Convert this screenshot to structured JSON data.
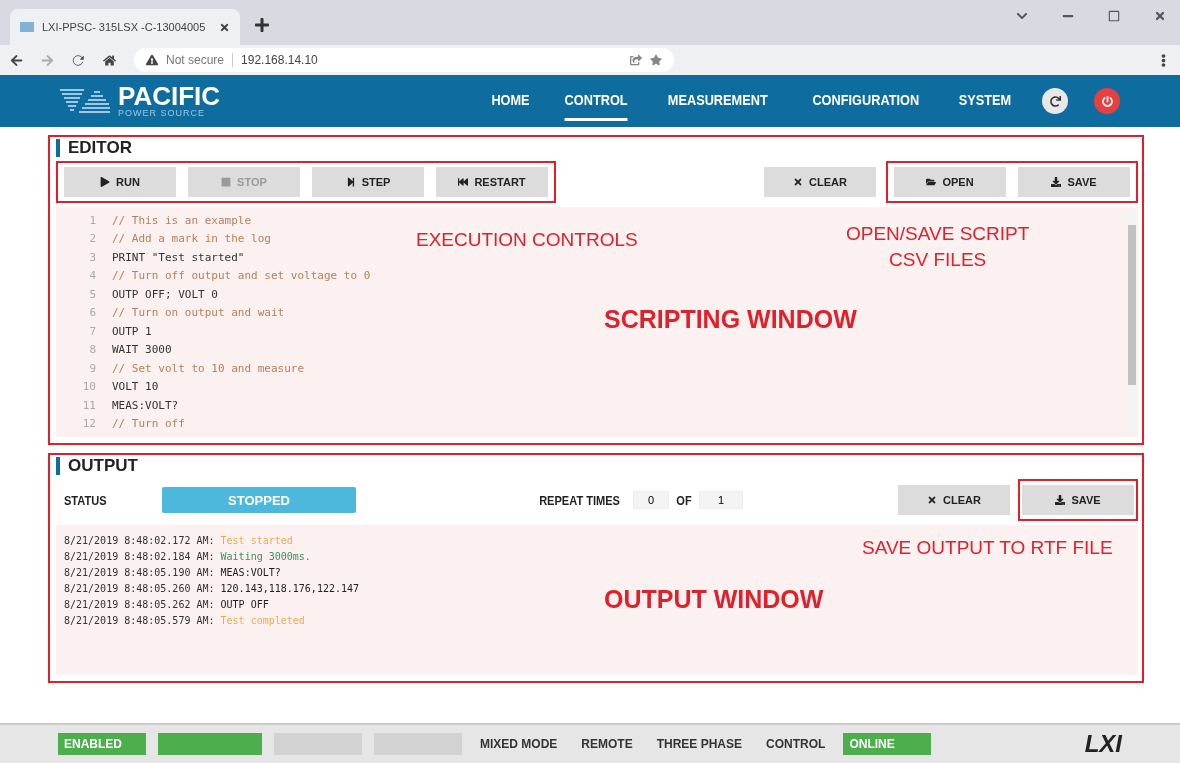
{
  "browser": {
    "tab_title": "LXI-PPSC- 315LSX -C-13004005",
    "security": "Not secure",
    "url": "192.168.14.10"
  },
  "header": {
    "logo_title": "PACIFIC",
    "logo_subtitle": "POWER SOURCE",
    "nav": [
      {
        "label": "HOME",
        "selected": false
      },
      {
        "label": "CONTROL",
        "selected": true
      },
      {
        "label": "MEASUREMENT",
        "selected": false
      },
      {
        "label": "CONFIGURATION",
        "selected": false
      },
      {
        "label": "SYSTEM",
        "selected": false
      }
    ]
  },
  "editor": {
    "title": "EDITOR",
    "exec_buttons": [
      {
        "label": "RUN",
        "disabled": false
      },
      {
        "label": "STOP",
        "disabled": true
      },
      {
        "label": "STEP",
        "disabled": false
      },
      {
        "label": "RESTART",
        "disabled": false
      }
    ],
    "clear": "CLEAR",
    "file_buttons": [
      {
        "label": "OPEN"
      },
      {
        "label": "SAVE"
      }
    ],
    "lines": [
      {
        "number": "1",
        "kind": "comment",
        "text": "// This is an example"
      },
      {
        "number": "2",
        "kind": "comment",
        "text": "// Add a mark in the log"
      },
      {
        "number": "3",
        "kind": "string",
        "text": "PRINT \"Test started\""
      },
      {
        "number": "4",
        "kind": "comment",
        "text": "// Turn off output and set voltage to 0"
      },
      {
        "number": "5",
        "kind": "code",
        "text": "OUTP OFF; VOLT 0"
      },
      {
        "number": "6",
        "kind": "comment",
        "text": "// Turn on output and wait"
      },
      {
        "number": "7",
        "kind": "code",
        "text": "OUTP 1"
      },
      {
        "number": "8",
        "kind": "code",
        "text": "WAIT 3000"
      },
      {
        "number": "9",
        "kind": "comment",
        "text": "// Set volt to 10 and measure"
      },
      {
        "number": "10",
        "kind": "code",
        "text": "VOLT 10"
      },
      {
        "number": "11",
        "kind": "code",
        "text": "MEAS:VOLT?"
      },
      {
        "number": "12",
        "kind": "comment",
        "text": "// Turn off"
      }
    ]
  },
  "output": {
    "title": "OUTPUT",
    "status_label": "STATUS",
    "status": "STOPPED",
    "repeat_label": "REPEAT TIMES",
    "repeat_count": "0",
    "of_label": "OF",
    "repeat_total": "1",
    "clear": "CLEAR",
    "save": "SAVE",
    "log": [
      {
        "time": "8/21/2019 8:48:02.172 AM:",
        "kind": "info",
        "message": "Test started"
      },
      {
        "time": "8/21/2019 8:48:02.184 AM:",
        "kind": "wait",
        "message": "Waiting 3000ms."
      },
      {
        "time": "8/21/2019 8:48:05.190 AM:",
        "kind": "command",
        "message": "MEAS:VOLT?"
      },
      {
        "time": "8/21/2019 8:48:05.260 AM:",
        "kind": "result",
        "message": "120.143,118.176,122.147"
      },
      {
        "time": "8/21/2019 8:48:05.262 AM:",
        "kind": "command",
        "message": "OUTP OFF"
      },
      {
        "time": "8/21/2019 8:48:05.579 AM:",
        "kind": "info",
        "message": "Test completed"
      }
    ]
  },
  "annotations": {
    "execution": "EXECUTION CONTROLS",
    "open_save": [
      "OPEN/SAVE SCRIPT",
      "CSV FILES"
    ],
    "scripting": "SCRIPTING WINDOW",
    "save_output": "SAVE OUTPUT TO RTF FILE",
    "output_window": "OUTPUT WINDOW"
  },
  "status_bar": {
    "items": [
      {
        "label": "ENABLED",
        "on": true
      },
      {
        "on": true
      },
      {
        "on": false
      },
      {
        "on": false
      },
      {
        "label": "MIXED MODE",
        "on": false
      },
      {
        "label": "REMOTE",
        "on": false
      },
      {
        "label": "THREE PHASE",
        "on": false
      },
      {
        "label": "CONTROL",
        "on": false
      },
      {
        "label": "ONLINE",
        "on": true
      }
    ],
    "logo": "LXI"
  }
}
